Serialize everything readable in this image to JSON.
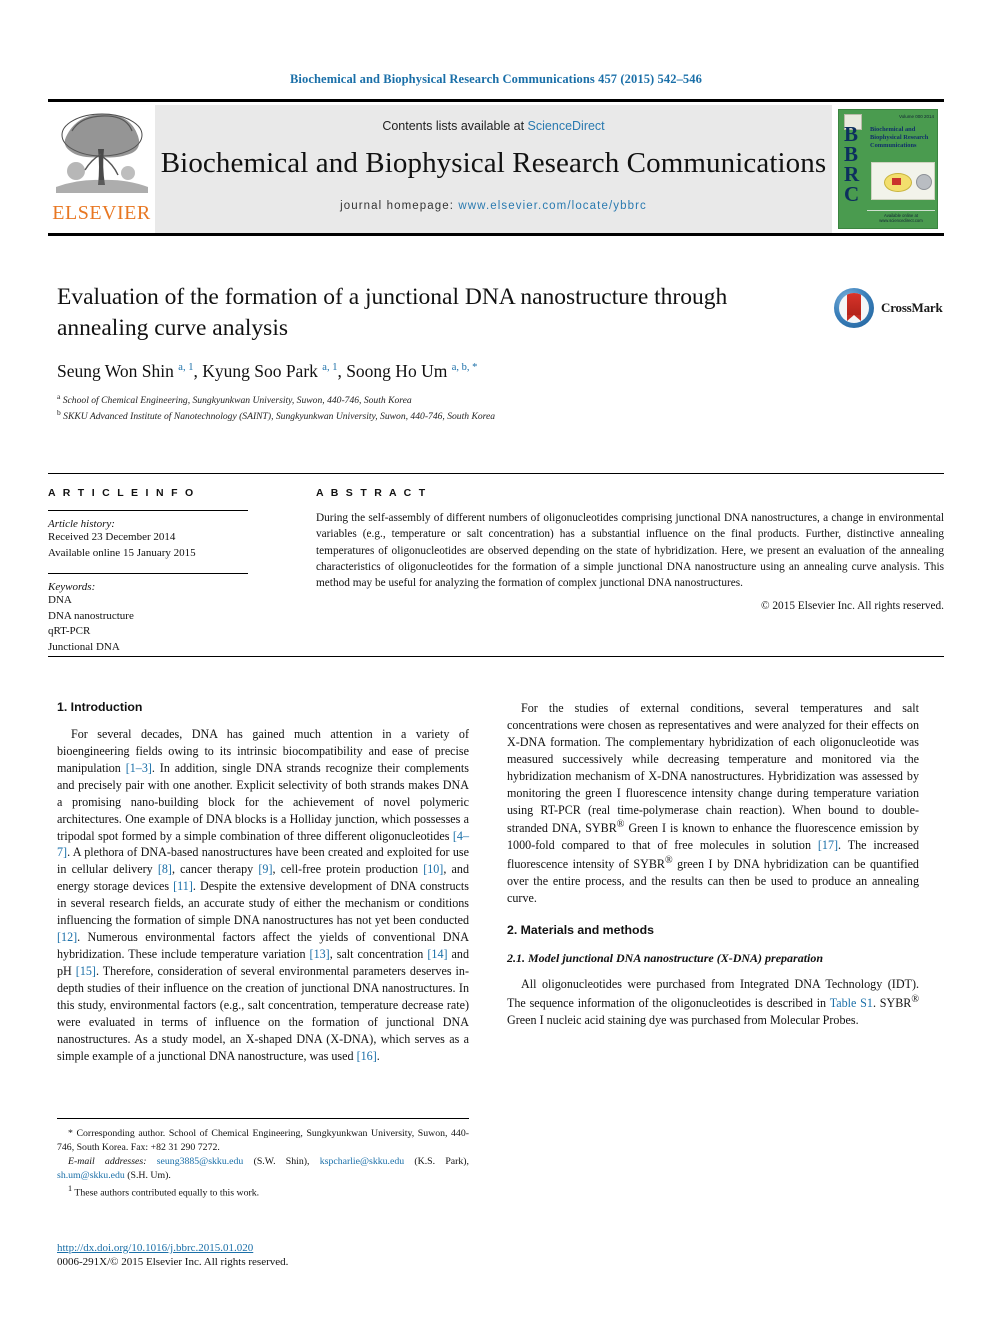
{
  "running_head": "Biochemical and Biophysical Research Communications 457 (2015) 542–546",
  "masthead": {
    "publisher_name": "ELSEVIER",
    "contents_prefix": "Contents lists available at ",
    "contents_link": "ScienceDirect",
    "journal_title": "Biochemical and Biophysical Research Communications",
    "homepage_label": "journal homepage: ",
    "homepage_url": "www.elsevier.com/locate/ybbrc",
    "cover": {
      "acronym": "BBRC",
      "title_lines": "Biochemical and Biophysical Research Communications",
      "top_label": "Volume 000  2014",
      "bottom_label": "Available online at www.sciencedirect.com"
    }
  },
  "article": {
    "title": "Evaluation of the formation of a junctional DNA nanostructure through annealing curve analysis",
    "authors_html": "Seung Won Shin <sup>a, 1</sup>, Kyung Soo Park <sup>a, 1</sup>, Soong Ho Um <sup>a, b, *</sup>",
    "affiliation_a": "School of Chemical Engineering, Sungkyunkwan University, Suwon, 440-746, South Korea",
    "affiliation_b": "SKKU Advanced Institute of Nanotechnology (SAINT), Sungkyunkwan University, Suwon, 440-746, South Korea",
    "crossmark_label": "CrossMark"
  },
  "article_info": {
    "heading": "A R T I C L E   I N F O",
    "history_label": "Article history:",
    "received": "Received 23 December 2014",
    "available": "Available online 15 January 2015",
    "keywords_label": "Keywords:",
    "keywords": [
      "DNA",
      "DNA nanostructure",
      "qRT-PCR",
      "Junctional DNA"
    ]
  },
  "abstract": {
    "heading": "A B S T R A C T",
    "text": "During the self-assembly of different numbers of oligonucleotides comprising junctional DNA nanostructures, a change in environmental variables (e.g., temperature or salt concentration) has a substantial influence on the final products. Further, distinctive annealing temperatures of oligonucleotides are observed depending on the state of hybridization. Here, we present an evaluation of the annealing characteristics of oligonucleotides for the formation of a simple junctional DNA nanostructure using an annealing curve analysis. This method may be useful for analyzing the formation of complex junctional DNA nanostructures.",
    "copyright": "© 2015 Elsevier Inc. All rights reserved."
  },
  "sections": {
    "intro_heading": "1.  Introduction",
    "intro_p1_a": "For several decades, DNA has gained much attention in a variety of bioengineering fields owing to its intrinsic biocompatibility and ease of precise manipulation ",
    "intro_p1_r1": "[1–3]",
    "intro_p1_b": ". In addition, single DNA strands recognize their complements and precisely pair with one another. Explicit selectivity of both strands makes DNA a promising nano-building block for the achievement of novel polymeric architectures. One example of DNA blocks is a Holliday junction, which possesses a tripodal spot formed by a simple combination of three different oligonucleotides ",
    "intro_p1_r2": "[4–7]",
    "intro_p1_c": ". A plethora of DNA-based nanostructures have been created and exploited for use in cellular delivery ",
    "intro_p1_r3": "[8]",
    "intro_p1_d": ", cancer therapy ",
    "intro_p1_r4": "[9]",
    "intro_p1_e": ", cell-free protein production ",
    "intro_p1_r5": "[10]",
    "intro_p1_f": ", and energy storage devices ",
    "intro_p1_r6": "[11]",
    "intro_p1_g": ". Despite the extensive development of DNA constructs in several research fields, an accurate study of either the mechanism or conditions influencing the formation of simple DNA nanostructures has not yet been conducted ",
    "intro_p1_r7": "[12]",
    "intro_p1_h": ". Numerous environmental factors affect the yields of conventional DNA hybridization. These include temperature variation ",
    "intro_p1_r8": "[13]",
    "intro_p1_i": ", salt concentration ",
    "intro_p1_r9": "[14]",
    "intro_p1_j": " and pH ",
    "intro_p1_r10": "[15]",
    "intro_p1_k": ". Therefore, consideration of several environmental parameters deserves in-depth studies of their influence on the creation of junctional DNA nanostructures. In this study, environmental factors (e.g., salt concentration, temperature decrease rate) were evaluated in terms of influence on the formation of junctional DNA nanostructures. As a study model, an X-shaped DNA (X-DNA), which serves as a simple example of a junctional DNA nanostructure, was used ",
    "intro_p1_r11": "[16]",
    "intro_p1_l": ".",
    "intro_p2_a": "For the studies of external conditions, several temperatures and salt concentrations were chosen as representatives and were analyzed for their effects on X-DNA formation. The complementary hybridization of each oligonucleotide was measured successively while decreasing temperature and monitored via the hybridization mechanism of X-DNA nanostructures. Hybridization was assessed by monitoring the green I fluorescence intensity change during temperature variation using RT-PCR (real time-polymerase chain reaction). When bound to double-stranded DNA, SYBR",
    "intro_p2_reg1": "®",
    "intro_p2_b": " Green I is known to enhance the fluorescence emission by 1000-fold compared to that of free molecules in solution ",
    "intro_p2_r1": "[17]",
    "intro_p2_c": ". The increased fluorescence intensity of SYBR",
    "intro_p2_reg2": "®",
    "intro_p2_d": " green I by DNA hybridization can be quantified over the entire process, and the results can then be used to produce an annealing curve.",
    "methods_heading": "2.  Materials and methods",
    "methods_sub": "2.1.  Model junctional DNA nanostructure (X-DNA) preparation",
    "methods_p1_a": "All oligonucleotides were purchased from Integrated DNA Technology (IDT). The sequence information of the oligonucleotides is described in ",
    "methods_p1_link": "Table S1",
    "methods_p1_b": ". SYBR",
    "methods_p1_reg": "®",
    "methods_p1_c": " Green I nucleic acid staining dye was purchased from Molecular Probes."
  },
  "footnotes": {
    "corresponding_mark": "*",
    "corresponding": " Corresponding author. School of Chemical Engineering, Sungkyunkwan University, Suwon, 440-746, South Korea. Fax: +82 31 290 7272.",
    "email_label": "E-mail addresses:",
    "email_1": "seung3885@skku.edu",
    "email_1_who": " (S.W. Shin), ",
    "email_2": "kspcharlie@skku.edu",
    "email_2_who": " (K.S. Park), ",
    "email_3": "sh.um@skku.edu",
    "email_3_who": " (S.H. Um).",
    "equal_mark": "1",
    "equal_contrib": " These authors contributed equally to this work.",
    "doi": "http://dx.doi.org/10.1016/j.bbrc.2015.01.020",
    "issn": "0006-291X/© 2015 Elsevier Inc. All rights reserved."
  },
  "colors": {
    "link_blue": "#1a6fa8",
    "elsevier_orange": "#e87722",
    "cover_green": "#4a9b4f"
  }
}
